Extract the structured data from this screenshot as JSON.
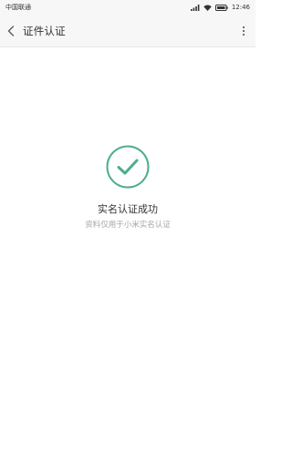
{
  "status_bar": {
    "carrier": "中国联通",
    "time": "12:46"
  },
  "app_bar": {
    "title": "证件认证",
    "back_icon": "chevron-left-icon",
    "more_icon": "more-vertical-icon"
  },
  "result": {
    "icon": "check-circle-icon",
    "title": "实名认证成功",
    "subtitle": "资料仅用于小米实名认证",
    "accent_color": "#4cae8b"
  }
}
